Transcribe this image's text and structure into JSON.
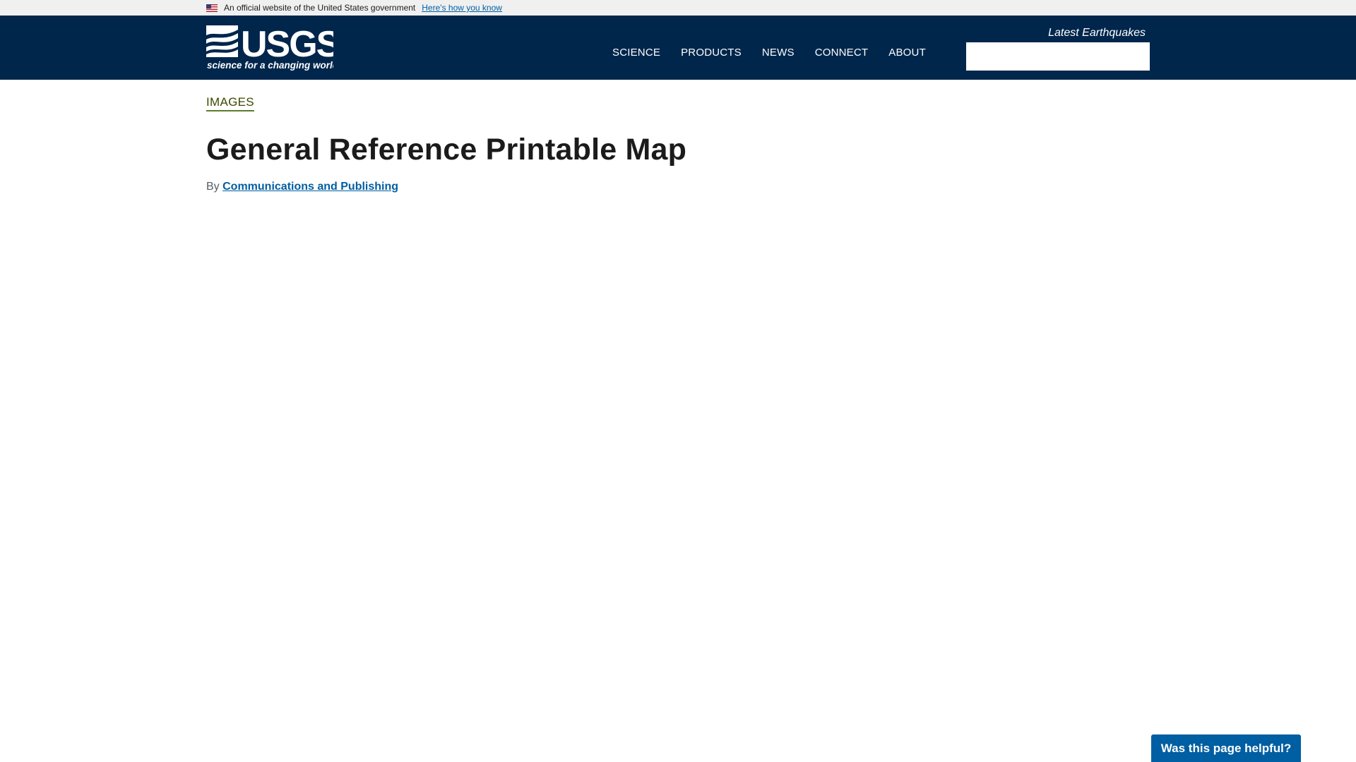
{
  "gov_banner": {
    "official_text": "An official website of the United States government",
    "how_you_know_label": "Here's how you know"
  },
  "header": {
    "logo": {
      "wordmark": "USGS",
      "tagline": "science for a changing world"
    },
    "nav": [
      {
        "label": "SCIENCE"
      },
      {
        "label": "PRODUCTS"
      },
      {
        "label": "NEWS"
      },
      {
        "label": "CONNECT"
      },
      {
        "label": "ABOUT"
      }
    ],
    "latest_earthquakes_label": "Latest Earthquakes",
    "search": {
      "value": "",
      "placeholder": ""
    }
  },
  "main": {
    "breadcrumb": "IMAGES",
    "title": "General Reference Printable Map",
    "byline_prefix": "By",
    "byline_author": "Communications and Publishing"
  },
  "feedback": {
    "button_label": "Was this page helpful?"
  },
  "colors": {
    "header_bg": "#00264c",
    "banner_bg": "#f0f0f0",
    "link_blue": "#005ea2",
    "breadcrumb_green": "#394a00",
    "button_blue": "#005ea2"
  }
}
